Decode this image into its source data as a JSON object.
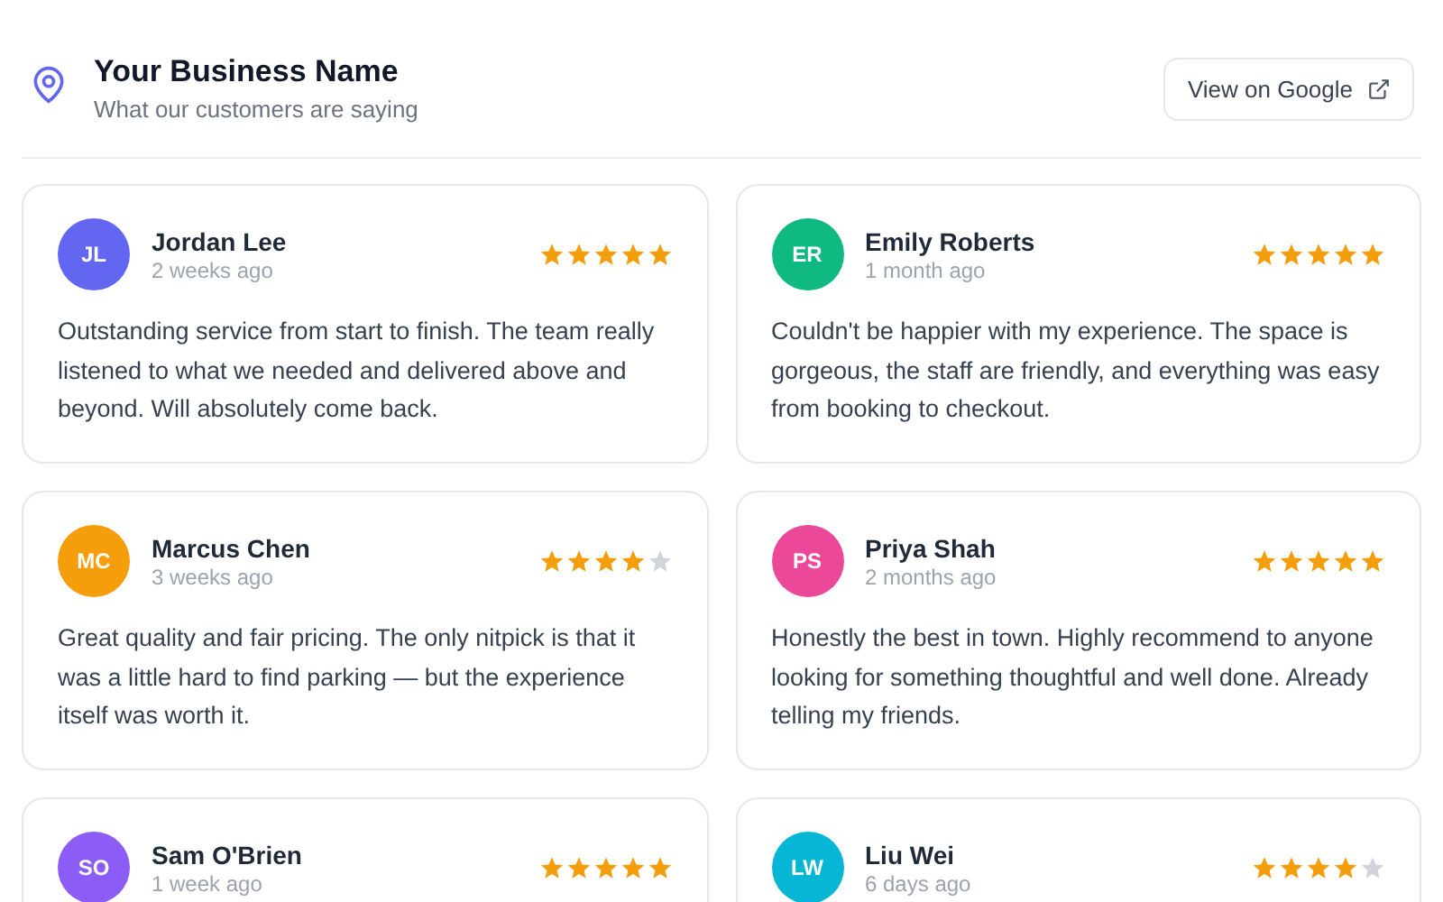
{
  "header": {
    "title": "Your Business Name",
    "subtitle": "What our customers are saying",
    "button": "View on Google"
  },
  "reviews": [
    {
      "initials": "JL",
      "color": "#6366f1",
      "name": "Jordan Lee",
      "time": "2 weeks ago",
      "stars": 5,
      "text": "Outstanding service from start to finish. The team really listened to what we needed and delivered above and beyond. Will absolutely come back."
    },
    {
      "initials": "ER",
      "color": "#10b981",
      "name": "Emily Roberts",
      "time": "1 month ago",
      "stars": 5,
      "text": "Couldn't be happier with my experience. The space is gorgeous, the staff are friendly, and everything was easy from booking to checkout."
    },
    {
      "initials": "MC",
      "color": "#f59e0b",
      "name": "Marcus Chen",
      "time": "3 weeks ago",
      "stars": 4,
      "text": "Great quality and fair pricing. The only nitpick is that it was a little hard to find parking — but the experience itself was worth it."
    },
    {
      "initials": "PS",
      "color": "#ec4899",
      "name": "Priya Shah",
      "time": "2 months ago",
      "stars": 5,
      "text": "Honestly the best in town. Highly recommend to anyone looking for something thoughtful and well done. Already telling my friends."
    },
    {
      "initials": "SO",
      "color": "#8b5cf6",
      "name": "Sam O'Brien",
      "time": "1 week ago",
      "stars": 5
    },
    {
      "initials": "LW",
      "color": "#06b6d4",
      "name": "Liu Wei",
      "time": "6 days ago",
      "stars": 4
    }
  ]
}
